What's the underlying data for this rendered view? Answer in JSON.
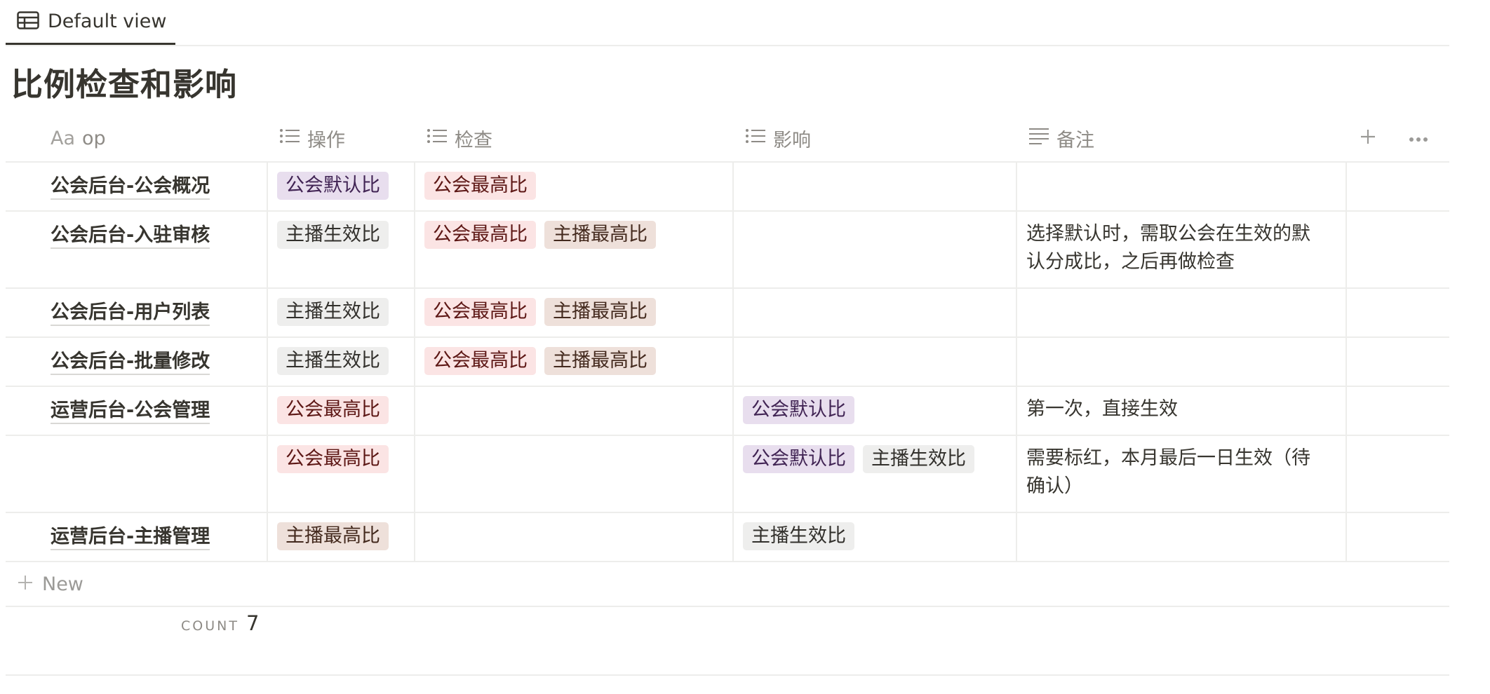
{
  "view": {
    "tab_label": "Default view"
  },
  "title": "比例检查和影响",
  "columns": {
    "op": {
      "type_label": "Aa",
      "label": "op"
    },
    "action": "操作",
    "check": "检查",
    "impact": "影响",
    "note": "备注"
  },
  "rows": [
    {
      "op": "公会后台-公会概况",
      "action": [
        "公会默认比"
      ],
      "check": [
        "公会最高比"
      ],
      "impact": [],
      "note": ""
    },
    {
      "op": "公会后台-入驻审核",
      "action": [
        "主播生效比"
      ],
      "check": [
        "公会最高比",
        "主播最高比"
      ],
      "impact": [],
      "note": [
        "选择默认时，需取公会在生效的默",
        "认分成比，之后再做检查"
      ]
    },
    {
      "op": "公会后台-用户列表",
      "action": [
        "主播生效比"
      ],
      "check": [
        "公会最高比",
        "主播最高比"
      ],
      "impact": [],
      "note": ""
    },
    {
      "op": "公会后台-批量修改",
      "action": [
        "主播生效比"
      ],
      "check": [
        "公会最高比",
        "主播最高比"
      ],
      "impact": [],
      "note": ""
    },
    {
      "op": "运营后台-公会管理",
      "action": [
        "公会最高比"
      ],
      "check": [],
      "impact": [
        "公会默认比"
      ],
      "note": [
        "第一次，直接生效"
      ]
    },
    {
      "op": "",
      "action": [
        "公会最高比"
      ],
      "check": [],
      "impact": [
        "公会默认比",
        "主播生效比"
      ],
      "note": [
        "需要标红，本月最后一日生效（待",
        "确认）"
      ]
    },
    {
      "op": "运营后台-主播管理",
      "action": [
        "主播最高比"
      ],
      "check": [],
      "impact": [
        "主播生效比"
      ],
      "note": ""
    }
  ],
  "tag_colors": {
    "公会默认比": "purple",
    "公会最高比": "red",
    "主播最高比": "brown",
    "主播生效比": "gray"
  },
  "new_label": "New",
  "footer": {
    "count_label": "COUNT",
    "count_value": "7"
  }
}
